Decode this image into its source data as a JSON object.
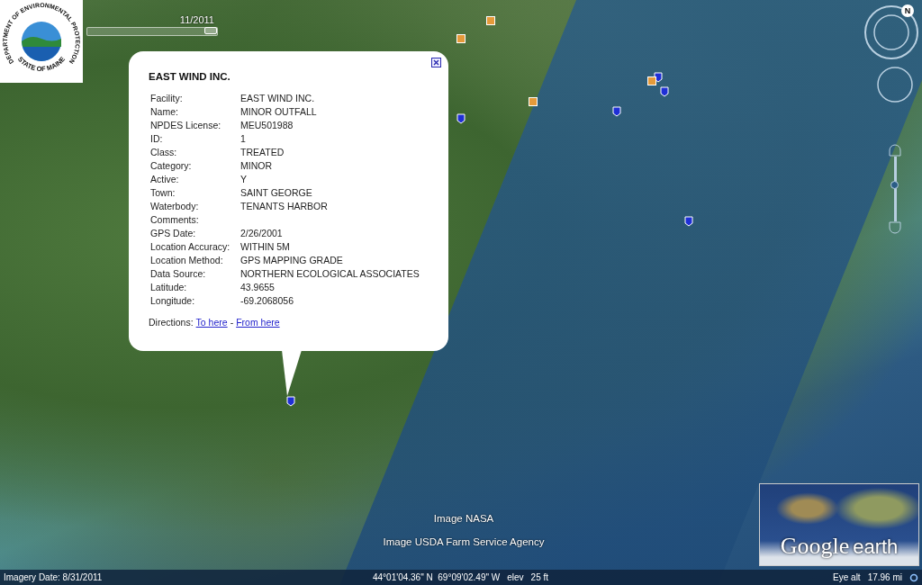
{
  "logo": {
    "top_text": "DEPARTMENT OF ENVIRONMENTAL PROTECTION",
    "bottom_text": "STATE OF MAINE"
  },
  "timeline": {
    "label": "11/2011",
    "level": 1
  },
  "zoom_slider": {
    "level": 0.55
  },
  "popup": {
    "title": "EAST WIND INC.",
    "fields": [
      {
        "label": "Facility:",
        "value": "EAST WIND INC."
      },
      {
        "label": "Name:",
        "value": "MINOR OUTFALL"
      },
      {
        "label": "NPDES License:",
        "value": "MEU501988"
      },
      {
        "label": "ID:",
        "value": "1"
      },
      {
        "label": "Class:",
        "value": "TREATED"
      },
      {
        "label": "Category:",
        "value": "MINOR"
      },
      {
        "label": "Active:",
        "value": "Y"
      },
      {
        "label": "Town:",
        "value": "SAINT GEORGE"
      },
      {
        "label": "Waterbody:",
        "value": "TENANTS HARBOR"
      },
      {
        "label": "Comments:"
      },
      {
        "label": "GPS Date:",
        "value": "2/26/2001"
      },
      {
        "label": "Location Accuracy:",
        "value": "WITHIN 5M"
      },
      {
        "label": "Location Method:",
        "value": "GPS MAPPING GRADE"
      },
      {
        "label": "Data Source:",
        "value": "NORTHERN ECOLOGICAL ASSOCIATES"
      },
      {
        "label": "Latitude:",
        "value": "43.9655"
      },
      {
        "label": "Longitude:",
        "value": "-69.2068056"
      }
    ],
    "directions": {
      "label": "Directions:",
      "links": [
        "To here",
        "From here"
      ],
      "separator": "-"
    }
  },
  "compass": {
    "label": "N"
  },
  "attributions": [
    "Image NASA",
    "Image USDA Farm Service Agency"
  ],
  "overview": {
    "brand": "Google",
    "product": "earth"
  },
  "status_bar": {
    "imagery_date": "Imagery Date: 8/31/2011",
    "coordinates": "44°01'04.36\" N  69°09'02.49\" W",
    "elevation_label": "elev",
    "elevation": "25 ft",
    "eye_alt_label": "Eye alt",
    "eye_alt": "17.96 mi"
  }
}
